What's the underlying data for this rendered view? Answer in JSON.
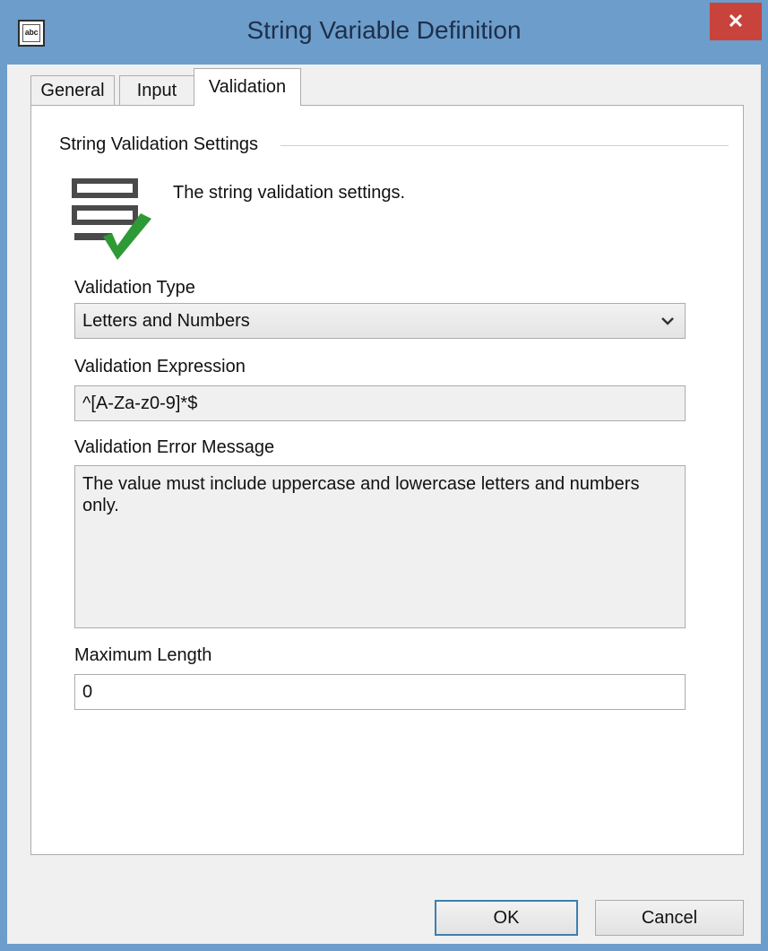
{
  "window": {
    "title": "String Variable Definition",
    "icon_text": "abc",
    "close_glyph": "✕"
  },
  "tabs": [
    {
      "label": "General",
      "active": false
    },
    {
      "label": "Input",
      "active": false
    },
    {
      "label": "Validation",
      "active": true
    }
  ],
  "section": {
    "title": "String Validation Settings",
    "description": "The string validation settings.",
    "icon": "list-check-icon"
  },
  "fields": {
    "validation_type": {
      "label": "Validation Type",
      "value": "Letters and Numbers"
    },
    "validation_expression": {
      "label": "Validation Expression",
      "value": "^[A-Za-z0-9]*$"
    },
    "validation_error": {
      "label": "Validation Error Message",
      "value": "The value must include uppercase and lowercase letters and numbers only."
    },
    "max_length": {
      "label": "Maximum Length",
      "value": "0"
    }
  },
  "buttons": {
    "ok": "OK",
    "cancel": "Cancel"
  },
  "colors": {
    "titlebar": "#6c9dcb",
    "close": "#c9433d",
    "check": "#2e9a36"
  }
}
